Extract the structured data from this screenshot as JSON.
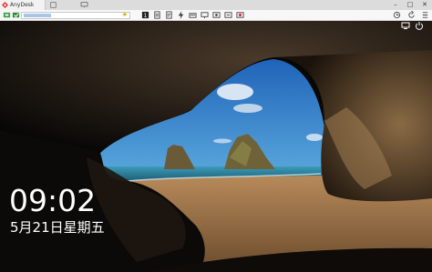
{
  "app": {
    "tab_title": "AnyDesk"
  },
  "lockscreen": {
    "time": "09:02",
    "date": "5月21日星期五"
  },
  "colors": {
    "brand": "#e8362d",
    "sky": "#2b78c9",
    "sea": "#2f8fae",
    "sand": "#a8784a"
  },
  "icons": {
    "toolbar_left": [
      "connection-icon",
      "connection-secure-icon"
    ],
    "toolbar_right": [
      "monitor-select-icon",
      "chat-icon",
      "lightning-icon",
      "keyboard-icon",
      "display-icon",
      "screenshot-icon",
      "tools-icon",
      "record-icon"
    ],
    "toolbar_far_right": [
      "history-icon",
      "reload-icon",
      "menu-icon"
    ],
    "lockscreen_corner": [
      "network-icon",
      "power-icon"
    ]
  }
}
